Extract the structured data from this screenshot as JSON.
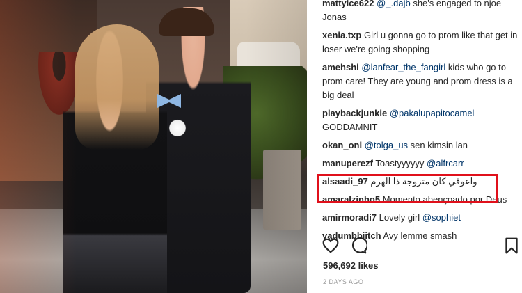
{
  "comments": [
    {
      "user": "mattyice622",
      "mention": "@_.dajb",
      "text": " she's engaged to njoe Jonas"
    },
    {
      "user": "xenia.txp",
      "mention": "",
      "text": "Girl u gonna go to prom like that get in loser we're going shopping"
    },
    {
      "user": "amehshi",
      "mention": "@lanfear_the_fangirl",
      "text": " kids who go to prom care! They are young and prom dress is a big deal"
    },
    {
      "user": "playbackjunkie",
      "mention": "@pakalupapitocamel",
      "text": " GODDAMNIT"
    },
    {
      "user": "okan_onl",
      "mention": "@tolga_us",
      "text": " sen kimsin lan"
    },
    {
      "user": "manuperezf",
      "mention": "@alfrcarr",
      "text": "Toastyyyyyy "
    },
    {
      "user": "alsaadi_97",
      "mention": "",
      "text": "واعوقي كان متزوجة ذا الهرم"
    },
    {
      "user": "amaralzinho5",
      "mention": "",
      "text": "Momento abençoado por Deus"
    },
    {
      "user": "amirmoradi7",
      "mention": "@sophiet",
      "text": "Lovely girl "
    },
    {
      "user": "vadumbbiitch",
      "mention": "",
      "text": "Avy lemme smash"
    }
  ],
  "actions": {
    "like_icon": "heart-icon",
    "comment_icon": "comment-icon",
    "save_icon": "bookmark-icon"
  },
  "likes_text": "596,692 likes",
  "timestamp": "2 DAYS AGO",
  "colors": {
    "text": "#262626",
    "mention": "#003569",
    "muted": "#999999",
    "highlight": "#e0101b"
  }
}
